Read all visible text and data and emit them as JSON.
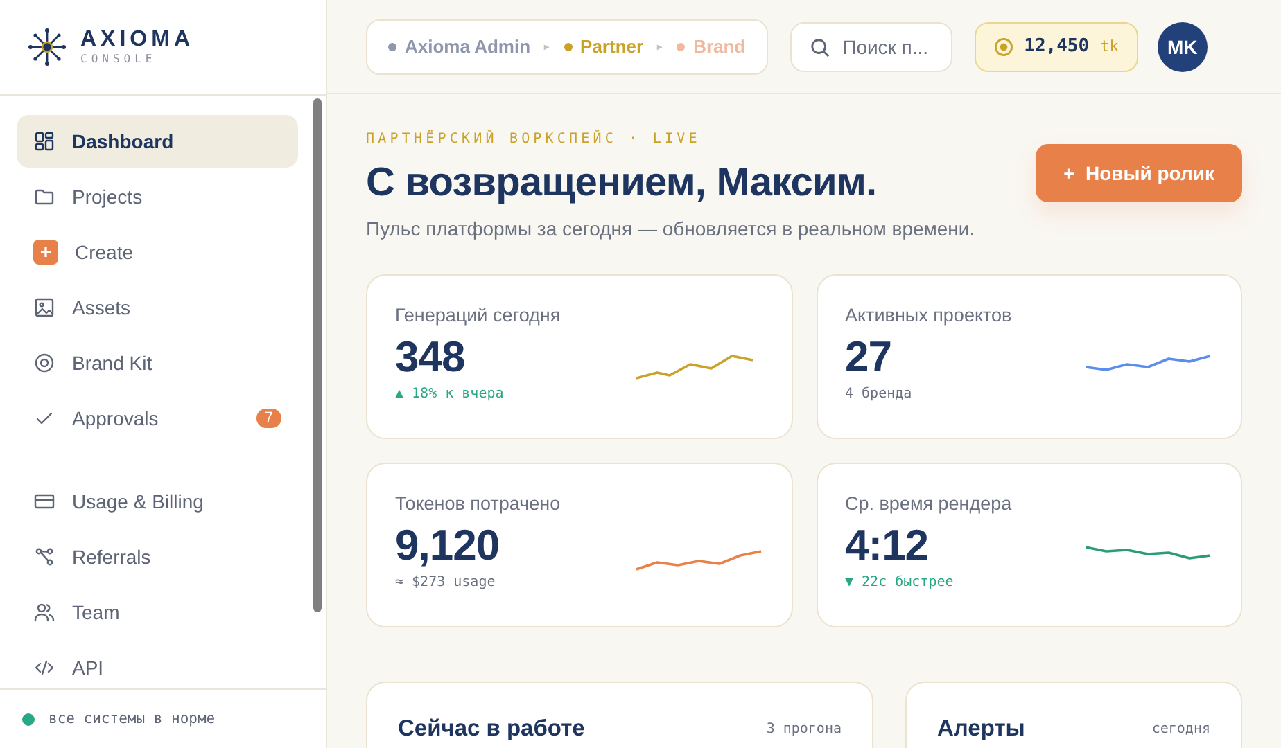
{
  "brand": {
    "name": "AXIOMA",
    "subtitle": "CONSOLE"
  },
  "sidebar": {
    "groups": [
      {
        "items": [
          {
            "label": "Dashboard",
            "selected": true
          },
          {
            "label": "Projects",
            "selected": false
          },
          {
            "label": "Create",
            "selected": false
          },
          {
            "label": "Assets",
            "selected": false
          },
          {
            "label": "Brand Kit",
            "selected": false
          },
          {
            "label": "Approvals",
            "selected": false,
            "badge": "7"
          }
        ]
      },
      {
        "items": [
          {
            "label": "Usage & Billing",
            "selected": false
          },
          {
            "label": "Referrals",
            "selected": false
          },
          {
            "label": "Team",
            "selected": false
          },
          {
            "label": "API",
            "selected": false
          }
        ]
      }
    ],
    "status": {
      "text": "все системы в норме",
      "color": "#2aa784"
    }
  },
  "breadcrumb": {
    "items": [
      {
        "label": "Axioma Admin",
        "color": "#8e97ab"
      },
      {
        "label": "Partner",
        "color": "#c9a227"
      },
      {
        "label": "Brand",
        "color": "#f0b9a0"
      }
    ],
    "separators": [
      "▸",
      "▸"
    ]
  },
  "search": {
    "placeholder": "Поиск п..."
  },
  "balance": {
    "amount": "12,450",
    "unit": "tk"
  },
  "avatar": {
    "initials": "MK"
  },
  "hero": {
    "eyebrow": "ПАРТНЁРСКИЙ ВОРКСПЕЙС · LIVE",
    "title": "С возвращением, Максим.",
    "subtitle": "Пульс платформы за сегодня — обновляется в реальном времени.",
    "button": "+  Новый ролик"
  },
  "stats": [
    {
      "label": "Генераций сегодня",
      "value": "348",
      "note": "▲ 18% к вчера",
      "kind": "trend",
      "color": "#c9a227"
    },
    {
      "label": "Активных проектов",
      "value": "27",
      "note": "4 бренда",
      "kind": "plain",
      "color": "#5b8def"
    },
    {
      "label": "Токенов потрачено",
      "value": "9,120",
      "note": "≈ $273 usage",
      "kind": "plain",
      "color": "#e8804a"
    },
    {
      "label": "Ср. время рендера",
      "value": "4:12",
      "note": "▼ 22с быстрее",
      "kind": "trend",
      "color": "#2a9d78"
    }
  ],
  "panels": [
    {
      "title": "Сейчас в работе",
      "meta": "3 прогона"
    },
    {
      "title": "Алерты",
      "meta": "сегодня"
    }
  ]
}
